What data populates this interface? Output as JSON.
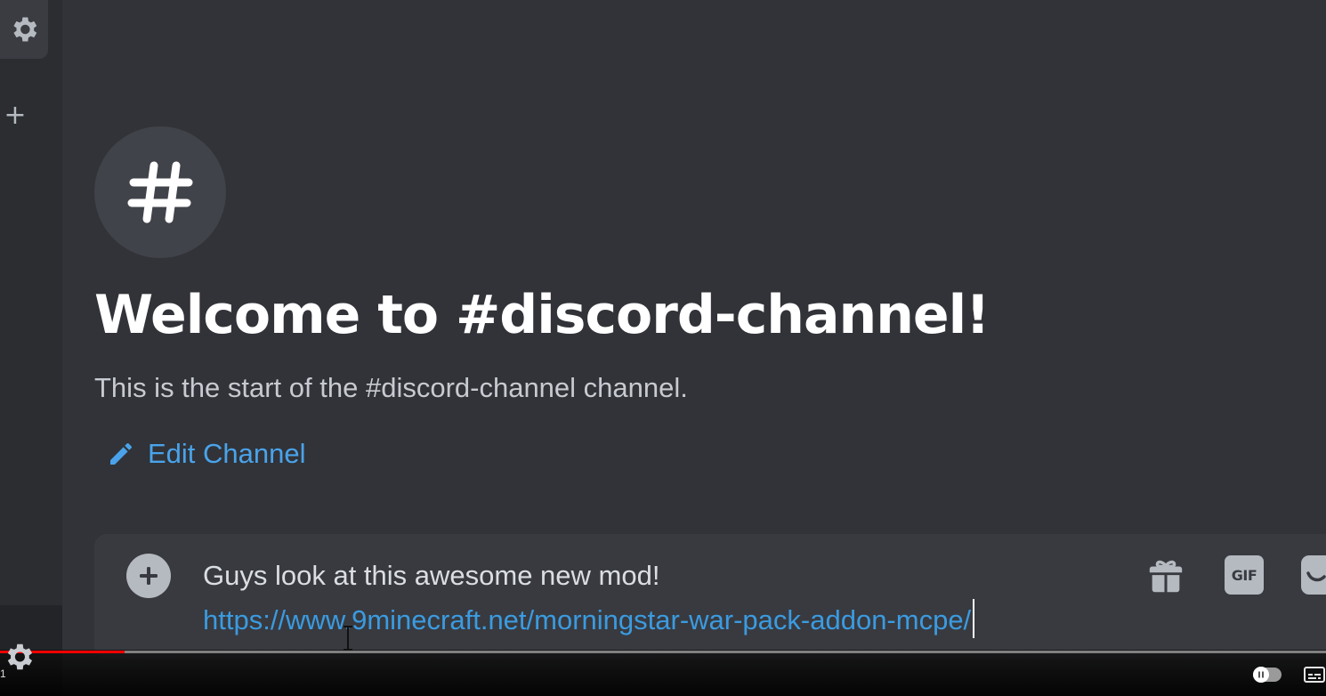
{
  "rail": {
    "top_icon": "gear-icon",
    "add_icon": "plus-icon",
    "add_label": "+",
    "bottom_icon": "gear-icon"
  },
  "channel": {
    "avatar_icon": "hash-icon",
    "welcome_title": "Welcome to #discord-channel!",
    "welcome_subtitle": "This is the start of the #discord-channel channel.",
    "edit_icon": "pencil-icon",
    "edit_label": "Edit Channel"
  },
  "composer": {
    "attach_icon": "plus-circle-icon",
    "message_line1": "Guys look at this awesome new mod!",
    "message_link": "https://www.9minecraft.net/morningstar-war-pack-addon-mcpe/",
    "gift_icon": "gift-icon",
    "gif_label": "GIF",
    "sticker_icon": "sticker-icon"
  },
  "player": {
    "progress_fraction": 0.094,
    "time_fragment": "1",
    "settings_icon": "gear-icon",
    "autoplay_icon": "pause-icon",
    "captions_icon": "captions-icon"
  },
  "colors": {
    "background": "#313338",
    "rail": "#2b2d31",
    "link": "#3b9be0",
    "accent_blue": "#4aa3ea",
    "progress": "#ff0000"
  }
}
